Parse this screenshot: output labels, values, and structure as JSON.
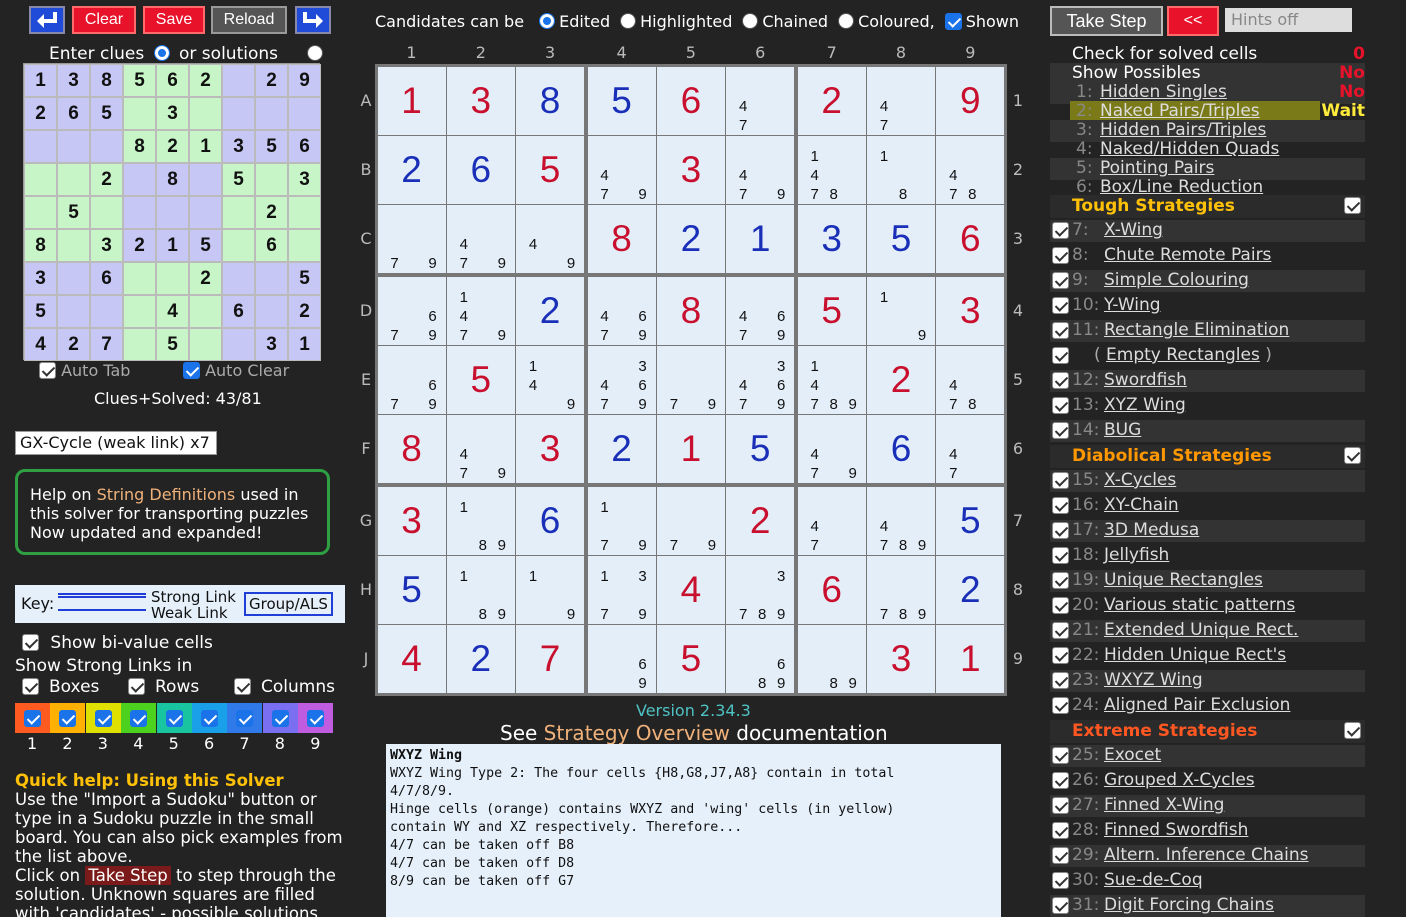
{
  "toolbar": {
    "clear": "Clear",
    "save": "Save",
    "reload": "Reload"
  },
  "candidates_bar": {
    "label": "Candidates can be",
    "options": [
      {
        "label": "Edited",
        "checked": true
      },
      {
        "label": "Highlighted",
        "checked": false
      },
      {
        "label": "Chained",
        "checked": false
      },
      {
        "label": "Coloured,",
        "checked": false
      },
      {
        "label": "Shown",
        "checked": true
      }
    ]
  },
  "enter": {
    "clues": "Enter clues",
    "solutions": "or solutions"
  },
  "small_board": {
    "rows": [
      "138562 29",
      "265 3    ",
      "   821356",
      "  2 8 5 3",
      " 5     2 ",
      "8 3215 6 ",
      "3 6  2  5",
      "5   4 6 2",
      "427 5  31"
    ],
    "cell_colors": [
      "#c7c7f5",
      "#c7f5c7",
      "#c7c7f5",
      "#c7f5c7",
      "#c7c7f5",
      "#c7f5c7",
      "#c7c7f5",
      "#c7f5c7",
      "#c7c7f5"
    ]
  },
  "auto_tab": "Auto Tab",
  "auto_clear": "Auto Clear",
  "clues_solved": "Clues+Solved: 43/81",
  "pattern_input": "GX-Cycle (weak link) x7",
  "help_box": {
    "l1a": "Help on ",
    "l1b": "String Definitions",
    "l1c": " used in",
    "l2": "this solver for transporting puzzles",
    "l3": "Now updated and expanded!"
  },
  "key": {
    "label": "Key:",
    "strong": "Strong Link",
    "weak": "Weak Link",
    "group": "Group/ALS"
  },
  "show_bivalue": "Show bi-value cells",
  "show_strong": "Show Strong Links in",
  "boxes": "Boxes",
  "rows": "Rows",
  "columns": "Columns",
  "digits": [
    "1",
    "2",
    "3",
    "4",
    "5",
    "6",
    "7",
    "8",
    "9"
  ],
  "digit_colors": [
    "#ff5a1f",
    "#ffb000",
    "#e0e000",
    "#4cd11e",
    "#19c5a0",
    "#1aa0e8",
    "#2f7ae8",
    "#7a6ff0",
    "#c05ce0"
  ],
  "quick_help": {
    "title": "Quick help: Using this Solver",
    "p1": "Use the \"Import a Sudoku\" button or type in a Sudoku puzzle in the small board. You can also pick examples from the list above.",
    "p2a": "Click on ",
    "p2b": "Take Step",
    "p2c": " to step through the solution. Unknown squares are filled with 'candidates' - possible solutions"
  },
  "col_labels": [
    "1",
    "2",
    "3",
    "4",
    "5",
    "6",
    "7",
    "8",
    "9"
  ],
  "row_labels": [
    "A",
    "B",
    "C",
    "D",
    "E",
    "F",
    "G",
    "H",
    "J"
  ],
  "board": [
    [
      "1r",
      "3r",
      "8b",
      "5b",
      "6r",
      "47",
      "2r",
      "47",
      "9r"
    ],
    [
      "2b",
      "6b",
      "5r",
      "479",
      "3r",
      "479",
      "1478",
      "18",
      "478"
    ],
    [
      "79",
      "479",
      "49",
      "8r",
      "2b",
      "1b",
      "3b",
      "5b",
      "6r"
    ],
    [
      "679",
      "1479",
      "2b",
      "4679",
      "8r",
      "4679",
      "5r",
      "19",
      "3r"
    ],
    [
      "679",
      "5r",
      "149",
      "34679",
      "79",
      "34679",
      "14789",
      "2r",
      "478"
    ],
    [
      "8r",
      "479",
      "3r",
      "2b",
      "1r",
      "5b",
      "479",
      "6b",
      "47"
    ],
    [
      "3r",
      "189",
      "6b",
      "179",
      "79",
      "2r",
      "47",
      "4789",
      "5b"
    ],
    [
      "5b",
      "189",
      "19",
      "1379",
      "4r",
      "3789",
      "6r",
      "789",
      "2b"
    ],
    [
      "4r",
      "2b",
      "7r",
      "69",
      "5r",
      "689",
      "89",
      "3r",
      "1r"
    ]
  ],
  "version": "Version 2.34.3",
  "see_doc": {
    "a": "See ",
    "b": "Strategy Overview",
    "c": " documentation"
  },
  "log": [
    "WXYZ Wing",
    "WXYZ Wing Type 2: The four cells {H8,G8,J7,A8} contain in total",
    "4/7/8/9.",
    "Hinge cells (orange) contains WXYZ and 'wing' cells (in yellow)",
    "contain WY and XZ respectively. Therefore...",
    "4/7 can be taken off B8",
    "4/7 can be taken off D8",
    "8/9 can be taken off G7"
  ],
  "right": {
    "take_step": "Take Step",
    "back": "<<",
    "hints": "Hints off",
    "check": "Check for solved cells",
    "check_val": "0",
    "show_poss": "Show Possibles",
    "show_poss_val": "No",
    "basic": [
      {
        "n": "1:",
        "t": "Hidden Singles",
        "v": "No"
      },
      {
        "n": "2:",
        "t": "Naked Pairs/Triples",
        "v": "Wait",
        "hl": true
      },
      {
        "n": "3:",
        "t": "Hidden Pairs/Triples",
        "v": ""
      },
      {
        "n": "4:",
        "t": "Naked/Hidden Quads",
        "v": ""
      },
      {
        "n": "5:",
        "t": "Pointing Pairs",
        "v": ""
      },
      {
        "n": "6:",
        "t": "Box/Line Reduction",
        "v": ""
      }
    ],
    "tough_title": "Tough Strategies",
    "tough": [
      {
        "n": "7:",
        "t": "X-Wing"
      },
      {
        "n": "8:",
        "t": "Chute Remote Pairs"
      },
      {
        "n": "9:",
        "t": "Simple Colouring"
      },
      {
        "n": "10:",
        "t": "Y-Wing"
      },
      {
        "n": "11:",
        "t": "Rectangle Elimination"
      },
      {
        "n": "",
        "t": "Empty Rectangles",
        "paren": true
      },
      {
        "n": "12:",
        "t": "Swordfish"
      },
      {
        "n": "13:",
        "t": "XYZ Wing"
      },
      {
        "n": "14:",
        "t": "BUG"
      }
    ],
    "diab_title": "Diabolical Strategies",
    "diab": [
      {
        "n": "15:",
        "t": "X-Cycles"
      },
      {
        "n": "16:",
        "t": "XY-Chain"
      },
      {
        "n": "17:",
        "t": "3D Medusa"
      },
      {
        "n": "18:",
        "t": "Jellyfish"
      },
      {
        "n": "19:",
        "t": "Unique Rectangles"
      },
      {
        "n": "20:",
        "t": "Various static patterns"
      },
      {
        "n": "21:",
        "t": "Extended Unique Rect."
      },
      {
        "n": "22:",
        "t": "Hidden Unique Rect's"
      },
      {
        "n": "23:",
        "t": "WXYZ Wing"
      },
      {
        "n": "24:",
        "t": "Aligned Pair Exclusion"
      }
    ],
    "ext_title": "Extreme Strategies",
    "ext": [
      {
        "n": "25:",
        "t": "Exocet"
      },
      {
        "n": "26:",
        "t": "Grouped X-Cycles"
      },
      {
        "n": "27:",
        "t": "Finned X-Wing"
      },
      {
        "n": "28:",
        "t": "Finned Swordfish"
      },
      {
        "n": "29:",
        "t": "Altern. Inference Chains"
      },
      {
        "n": "30:",
        "t": "Sue-de-Coq"
      },
      {
        "n": "31:",
        "t": "Digit Forcing Chains"
      }
    ]
  }
}
